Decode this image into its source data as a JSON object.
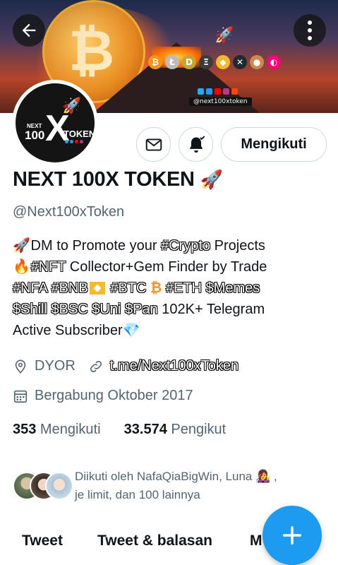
{
  "header": {
    "banner_handle": "@next100xtoken",
    "avatar_text": {
      "top": "NEXT",
      "left": "100",
      "x": "X",
      "right": "TOKEN"
    }
  },
  "profile": {
    "name": "NEXT 100X TOKEN",
    "handle": "@Next100xToken",
    "follow_button": "Mengikuti",
    "bio": {
      "line1_text": " DM to Promote your ",
      "line1_tag": "#Crypto",
      "line1_end": " Projects",
      "line2_tag": "#NFT",
      "line2_text": " Collector+Gem Finder by Trade",
      "line3_tags": [
        "#NFA",
        "#BNB",
        "#BTC",
        "#ETH",
        "$Memes"
      ],
      "line4_tags": [
        "$Shill",
        "$BSC",
        "$Uni",
        "$Pan"
      ],
      "line4_text": " 102K+ Telegram",
      "line5_text": "Active Subscriber"
    },
    "location": "DYOR",
    "link": "t.me/Next100xToken",
    "joined": "Bergabung Oktober 2017",
    "following_count": "353",
    "following_label": " Mengikuti",
    "followers_count": "33.574",
    "followers_label": " Pengikut",
    "followed_by_line1": "Diikuti oleh NafaQiaBigWin, Luna",
    "followed_by_line2": "je limit, dan 100 lainnya"
  },
  "tabs": [
    "Tweet",
    "Tweet & balasan",
    "M"
  ],
  "icons": {
    "back": "arrow-left-icon",
    "more": "more-vertical-icon",
    "message": "envelope-icon",
    "notify": "bell-check-icon",
    "location": "location-pin-icon",
    "link": "link-icon",
    "calendar": "calendar-icon",
    "compose": "plus-icon"
  },
  "colors": {
    "accent": "#1d9bf0",
    "text": "#0f1419",
    "muted": "#536471",
    "border": "#cfd9de"
  }
}
